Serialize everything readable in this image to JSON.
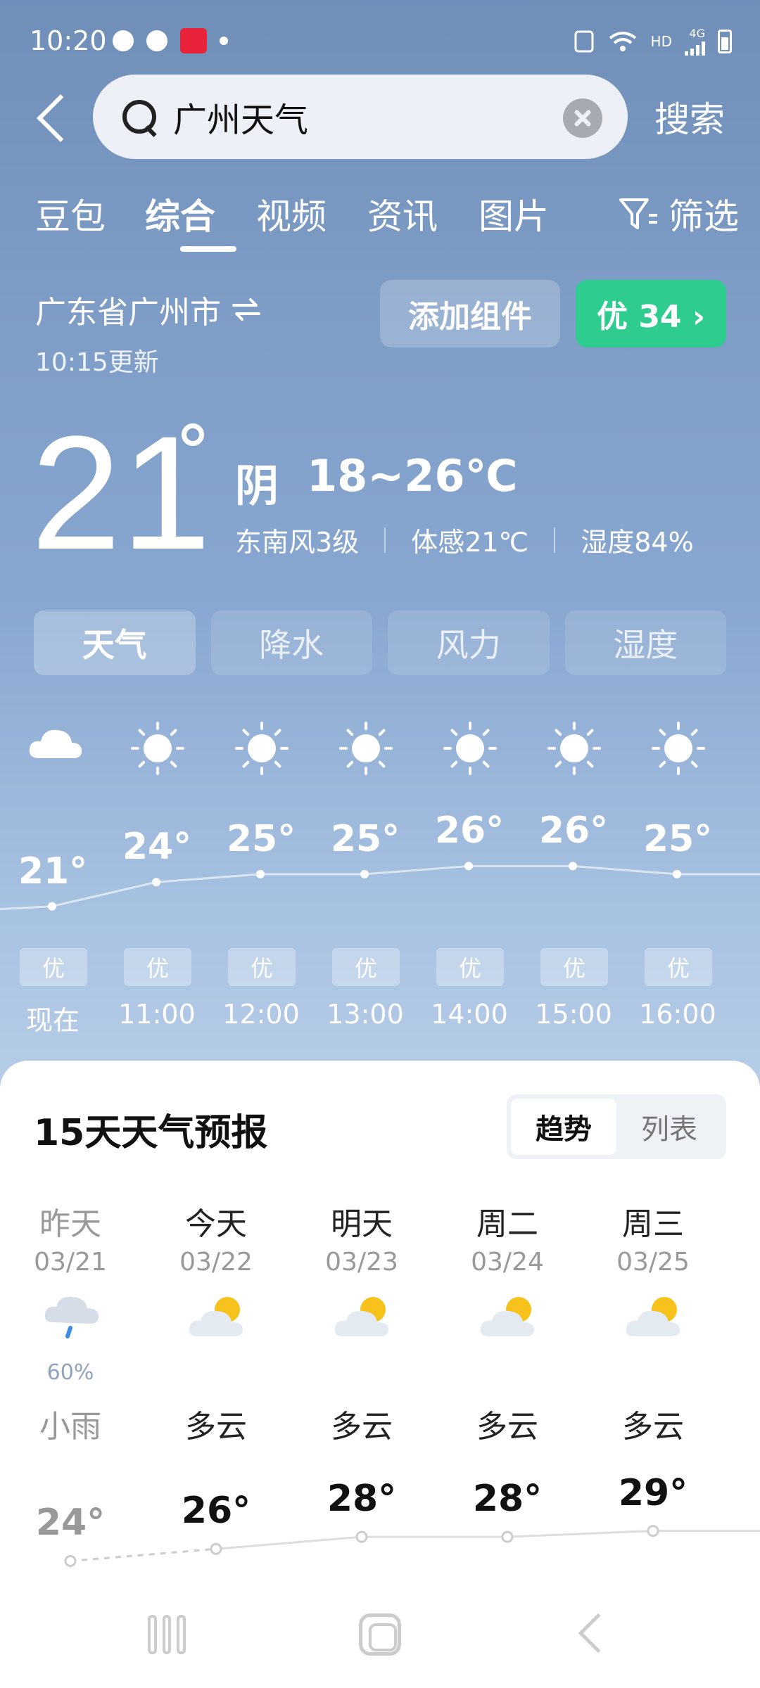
{
  "status_bar": {
    "time": "10:20",
    "network_label": "HD",
    "network_type": "4G"
  },
  "search": {
    "query": "广州天气",
    "submit_label": "搜索"
  },
  "tabs": [
    {
      "label": "豆包"
    },
    {
      "label": "综合",
      "active": true
    },
    {
      "label": "视频"
    },
    {
      "label": "资讯"
    },
    {
      "label": "图片"
    }
  ],
  "filter_label": "筛选",
  "location": {
    "name": "广东省广州市",
    "updated": "10:15更新",
    "add_widget_label": "添加组件",
    "aqi_label": "优 34 ›",
    "aqi_color": "#2ecc8f"
  },
  "current": {
    "temp": "21",
    "condition": "阴",
    "range": "18~26℃",
    "wind": "东南风3级",
    "feels_like": "体感21℃",
    "humidity": "湿度84%"
  },
  "metric_tabs": [
    {
      "label": "天气",
      "active": true
    },
    {
      "label": "降水"
    },
    {
      "label": "风力"
    },
    {
      "label": "湿度"
    }
  ],
  "hourly": [
    {
      "time": "现在",
      "temp": "21°",
      "aqi": "优",
      "icon": "cloud-icon",
      "value": 21
    },
    {
      "time": "11:00",
      "temp": "24°",
      "aqi": "优",
      "icon": "sun-icon",
      "value": 24
    },
    {
      "time": "12:00",
      "temp": "25°",
      "aqi": "优",
      "icon": "sun-icon",
      "value": 25
    },
    {
      "time": "13:00",
      "temp": "25°",
      "aqi": "优",
      "icon": "sun-icon",
      "value": 25
    },
    {
      "time": "14:00",
      "temp": "26°",
      "aqi": "优",
      "icon": "sun-icon",
      "value": 26
    },
    {
      "time": "15:00",
      "temp": "26°",
      "aqi": "优",
      "icon": "sun-icon",
      "value": 26
    },
    {
      "time": "16:00",
      "temp": "25°",
      "aqi": "优",
      "icon": "sun-icon",
      "value": 25
    }
  ],
  "forecast": {
    "title": "15天天气预报",
    "view_trend": "趋势",
    "view_list": "列表",
    "days": [
      {
        "name": "昨天",
        "date": "03/21",
        "pop": "60%",
        "condition": "小雨",
        "temp": "24°",
        "value": 24,
        "icon": "rain-cloud-icon",
        "past": true
      },
      {
        "name": "今天",
        "date": "03/22",
        "pop": "",
        "condition": "多云",
        "temp": "26°",
        "value": 26,
        "icon": "partly-cloudy-icon"
      },
      {
        "name": "明天",
        "date": "03/23",
        "pop": "",
        "condition": "多云",
        "temp": "28°",
        "value": 28,
        "icon": "partly-cloudy-icon"
      },
      {
        "name": "周二",
        "date": "03/24",
        "pop": "",
        "condition": "多云",
        "temp": "28°",
        "value": 28,
        "icon": "partly-cloudy-icon"
      },
      {
        "name": "周三",
        "date": "03/25",
        "pop": "",
        "condition": "多云",
        "temp": "29°",
        "value": 29,
        "icon": "partly-cloudy-icon"
      }
    ]
  }
}
